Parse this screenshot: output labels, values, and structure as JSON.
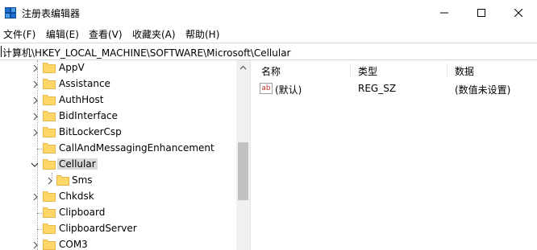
{
  "window": {
    "title": "注册表编辑器",
    "app_icon": "registry-editor-icon",
    "controls": [
      "minimize-icon",
      "maximize-icon",
      "close-icon"
    ]
  },
  "menu": {
    "items": [
      "文件(F)",
      "编辑(E)",
      "查看(V)",
      "收藏夹(A)",
      "帮助(H)"
    ]
  },
  "address": {
    "path": "计算机\\HKEY_LOCAL_MACHINE\\SOFTWARE\\Microsoft\\Cellular"
  },
  "tree": {
    "items": [
      {
        "label": "AppV",
        "expandable": true,
        "expanded": false,
        "selected": false
      },
      {
        "label": "Assistance",
        "expandable": true,
        "expanded": false,
        "selected": false
      },
      {
        "label": "AuthHost",
        "expandable": true,
        "expanded": false,
        "selected": false
      },
      {
        "label": "BidInterface",
        "expandable": true,
        "expanded": false,
        "selected": false
      },
      {
        "label": "BitLockerCsp",
        "expandable": true,
        "expanded": false,
        "selected": false
      },
      {
        "label": "CallAndMessagingEnhancement",
        "expandable": false,
        "expanded": false,
        "selected": false
      },
      {
        "label": "Cellular",
        "expandable": true,
        "expanded": true,
        "selected": true
      },
      {
        "label": "Sms",
        "expandable": true,
        "expanded": false,
        "selected": false,
        "child": true
      },
      {
        "label": "Chkdsk",
        "expandable": true,
        "expanded": false,
        "selected": false
      },
      {
        "label": "Clipboard",
        "expandable": false,
        "expanded": false,
        "selected": false
      },
      {
        "label": "ClipboardServer",
        "expandable": false,
        "expanded": false,
        "selected": false
      },
      {
        "label": "COM3",
        "expandable": true,
        "expanded": false,
        "selected": false
      }
    ]
  },
  "list": {
    "columns": [
      "名称",
      "类型",
      "数据"
    ],
    "rows": [
      {
        "icon": "string-value-icon",
        "icon_text": "ab",
        "name": "(默认)",
        "type": "REG_SZ",
        "data": "(数值未设置)"
      }
    ]
  },
  "colors": {
    "folder_fill": "#ffd767",
    "folder_tab": "#e8b64c",
    "selection": "#d9d9d9",
    "scroll_thumb": "#c1c1c1"
  }
}
